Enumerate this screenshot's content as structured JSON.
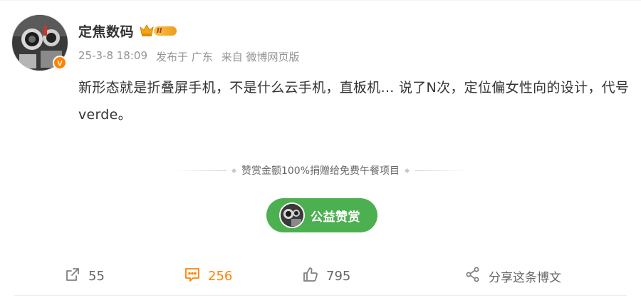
{
  "post": {
    "username": "定焦数码",
    "vip_level": "II",
    "timestamp": "25-3-8 18:09",
    "published_in": "发布于 广东",
    "source": "来自 微博网页版",
    "text": "新形态就是折叠屏手机，不是什么云手机，直板机... 说了N次，定位偏女性向的设计，代号verde。"
  },
  "reward": {
    "notice": "赞赏金额100%捐赠给免费午餐项目",
    "button_label": "公益赞赏"
  },
  "actions": {
    "forward_count": "55",
    "comment_count": "256",
    "like_count": "795",
    "share_label": "分享这条博文"
  },
  "colors": {
    "accent_orange": "#ff8200",
    "reward_green": "#4cb050",
    "text_main": "#333333",
    "text_meta": "#939393"
  },
  "icons": {
    "forward": "forward-icon",
    "comment": "comment-icon",
    "like": "like-icon",
    "share": "share-icon",
    "verified": "verified-badge-icon",
    "vip": "crown-vip-icon"
  }
}
